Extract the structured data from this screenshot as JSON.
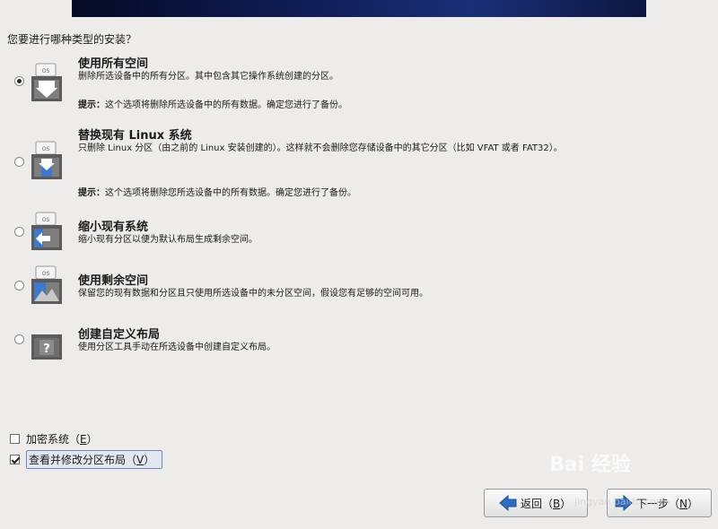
{
  "question": "您要进行哪种类型的安装？",
  "options": [
    {
      "title": "使用所有空间",
      "desc": "删除所选设备中的所有分区。其中包含其它操作系统创建的分区。",
      "hint_label": "提示：",
      "hint_text": "这个选项将删除所选设备中的所有数据。确定您进行了备份。",
      "icon": "drive-os-full-icon",
      "selected": true
    },
    {
      "title": "替换现有 Linux 系统",
      "desc": "只删除 Linux 分区（由之前的 Linux 安装创建的）。这样就不会删除您存储设备中的其它分区（比如 VFAT 或者 FAT32）。",
      "hint_label": "提示：",
      "hint_text": "这个选项将删除您所选设备中的所有数据。确定您进行了备份。",
      "icon": "drive-os-replace-icon",
      "selected": false
    },
    {
      "title": "缩小现有系统",
      "desc": "缩小现有分区以便为默认布局生成剩余空间。",
      "icon": "drive-os-shrink-icon",
      "selected": false
    },
    {
      "title": "使用剩余空间",
      "desc": "保留您的现有数据和分区且只使用所选设备中的未分区空间，假设您有足够的空间可用。",
      "icon": "drive-os-free-space-icon",
      "selected": false
    },
    {
      "title": "创建自定义布局",
      "desc": "使用分区工具手动在所选设备中创建自定义布局。",
      "icon": "drive-question-icon",
      "selected": false
    }
  ],
  "icon_os_label": "OS",
  "icon_unknown_label": "?",
  "encrypt": {
    "label": "加密系统（",
    "key": "E",
    "end": "）",
    "checked": false
  },
  "review": {
    "label": "查看并修改分区布局（",
    "key": "V",
    "end": "）",
    "checked": true
  },
  "buttons": {
    "back": {
      "label": "返回（",
      "key": "B",
      "end": "）"
    },
    "next": {
      "label": "下一步（",
      "key": "N",
      "end": "）"
    }
  },
  "watermark": {
    "main": "Bai 经验",
    "sub": "jingyan.baidu.com"
  },
  "colors": {
    "banner": "#0f1d55",
    "icon_blue": "#3d78c9",
    "arrow_blue": "#2f6bbf"
  }
}
